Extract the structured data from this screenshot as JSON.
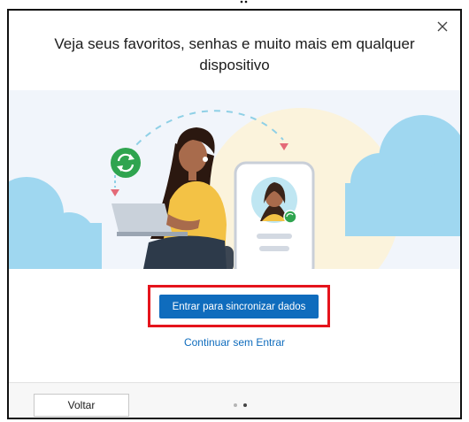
{
  "dialog": {
    "title": "Veja seus favoritos, senhas e muito mais em qualquer dispositivo",
    "primary_button": "Entrar para sincronizar dados",
    "secondary_link": "Continuar sem Entrar",
    "back_button": "Voltar"
  },
  "pagination": {
    "total": 2,
    "current": 2
  },
  "colors": {
    "accent": "#0f6cbd",
    "highlight": "#e5141c",
    "sync_badge": "#2fa44f",
    "cloud": "#9fd7f0"
  },
  "icons": {
    "close": "close-icon",
    "sync": "sync-icon",
    "person": "person-icon"
  }
}
